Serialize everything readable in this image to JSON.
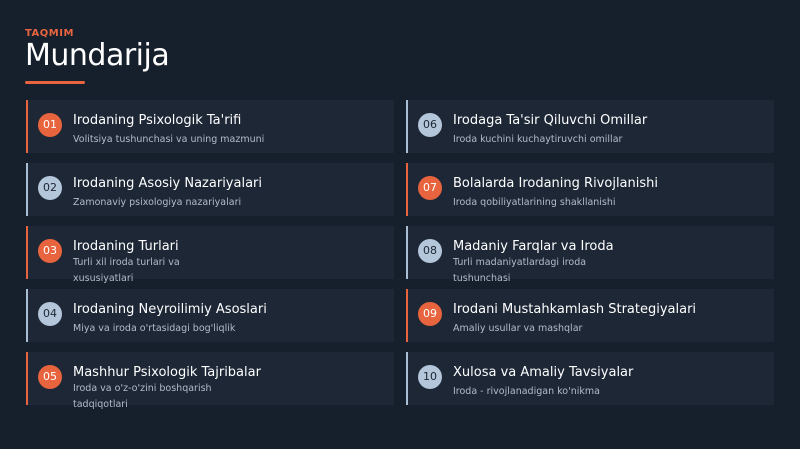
{
  "header": {
    "kicker": "TAQMIM",
    "title": "Mundarija"
  },
  "colors": {
    "accent_orange": "#e8643f",
    "accent_blue": "#b4c6da",
    "background": "#161f2c",
    "card": "#1d2736"
  },
  "items": [
    {
      "num": "01",
      "title": "Irodaning Psixologik Ta'rifi",
      "subtitle": "Volitsiya tushunchasi va uning mazmuni",
      "accent": "orange"
    },
    {
      "num": "02",
      "title": "Irodaning Asosiy Nazariyalari",
      "subtitle": "Zamonaviy psixologiya nazariyalari",
      "accent": "blue"
    },
    {
      "num": "03",
      "title": "Irodaning Turlari",
      "subtitle": "Turli xil iroda turlari va xususiyatlari",
      "accent": "orange"
    },
    {
      "num": "04",
      "title": "Irodaning Neyroilimiy Asoslari",
      "subtitle": "Miya va iroda o'rtasidagi bog'liqlik",
      "accent": "blue"
    },
    {
      "num": "05",
      "title": "Mashhur Psixologik Tajribalar",
      "subtitle": "Iroda va o'z-o'zini boshqarish tadqiqotlari",
      "accent": "orange"
    },
    {
      "num": "06",
      "title": "Irodaga Ta'sir Qiluvchi Omillar",
      "subtitle": "Iroda kuchini kuchaytiruvchi omillar",
      "accent": "blue"
    },
    {
      "num": "07",
      "title": "Bolalarda Irodaning Rivojlanishi",
      "subtitle": "Iroda qobiliyatlarining shakllanishi",
      "accent": "orange"
    },
    {
      "num": "08",
      "title": "Madaniy Farqlar va Iroda",
      "subtitle": "Turli madaniyatlardagi iroda tushunchasi",
      "accent": "blue"
    },
    {
      "num": "09",
      "title": "Irodani Mustahkamlash Strategiyalari",
      "subtitle": "Amaliy usullar va mashqlar",
      "accent": "orange"
    },
    {
      "num": "10",
      "title": "Xulosa va Amaliy Tavsiyalar",
      "subtitle": "Iroda - rivojlanadigan ko'nikma",
      "accent": "blue"
    }
  ]
}
